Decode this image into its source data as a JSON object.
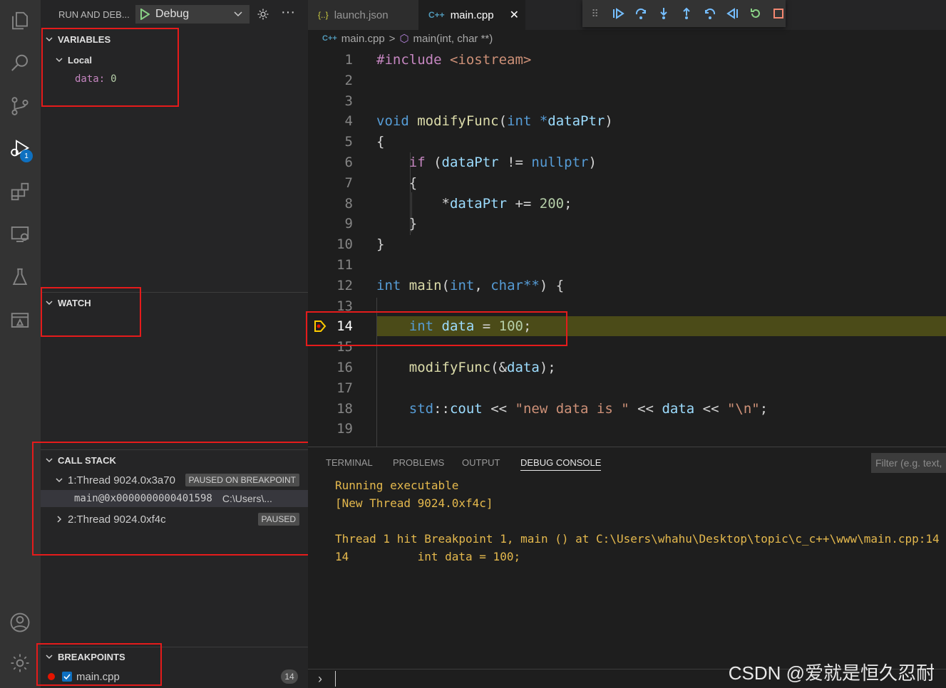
{
  "sidebar": {
    "title": "RUN AND DEB...",
    "debug_config": "Debug",
    "variables": {
      "header": "VARIABLES",
      "scope": "Local",
      "items": [
        {
          "name": "data:",
          "value": "0"
        }
      ]
    },
    "watch": {
      "header": "WATCH"
    },
    "call_stack": {
      "header": "CALL STACK",
      "threads": [
        {
          "label": "1:Thread 9024.0x3a70",
          "status": "PAUSED ON BREAKPOINT"
        },
        {
          "label": "2:Thread 9024.0xf4c",
          "status": "PAUSED"
        }
      ],
      "frame": {
        "name": "main@0x0000000000401598",
        "path": "C:\\Users\\..."
      }
    },
    "breakpoints": {
      "header": "BREAKPOINTS",
      "file": "main.cpp",
      "count": "14"
    },
    "debug_badge": "1"
  },
  "editor": {
    "tabs": [
      {
        "label": "launch.json",
        "icon": "{..}"
      },
      {
        "label": "main.cpp",
        "icon": "C++"
      }
    ],
    "breadcrumb": {
      "file": "main.cpp",
      "symbol": "main(int, char **)"
    },
    "line_numbers": [
      "1",
      "2",
      "3",
      "4",
      "5",
      "6",
      "7",
      "8",
      "9",
      "10",
      "11",
      "12",
      "13",
      "14",
      "15",
      "16",
      "17",
      "18",
      "19"
    ],
    "current_line": "14"
  },
  "panel": {
    "tabs": [
      "TERMINAL",
      "PROBLEMS",
      "OUTPUT",
      "DEBUG CONSOLE"
    ],
    "filter_placeholder": "Filter (e.g. text,",
    "output": [
      "Running executable",
      "[New Thread 9024.0xf4c]",
      "",
      "Thread 1 hit Breakpoint 1, main () at C:\\Users\\whahu\\Desktop\\topic\\c_c++\\www\\main.cpp:14",
      "14          int data = 100;"
    ]
  },
  "watermark": "CSDN @爱就是恒久忍耐",
  "colors": {
    "accent": "#0e70c0",
    "highlight_box": "#e51b1b",
    "console_text": "#e5b94d",
    "current_line": "#4b4b18"
  }
}
